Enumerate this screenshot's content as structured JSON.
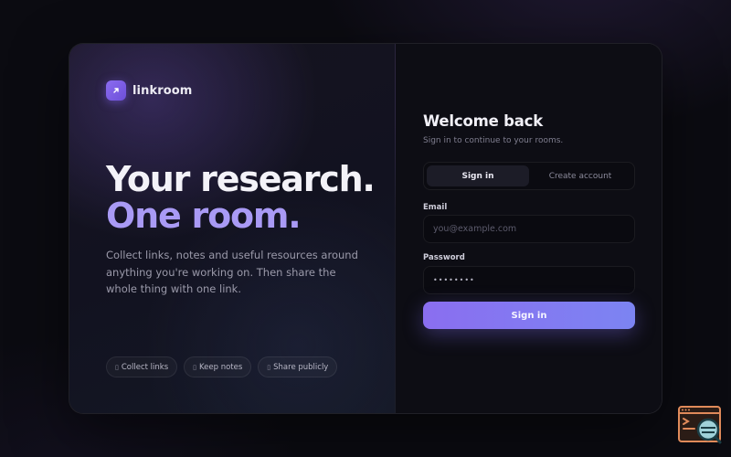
{
  "brand": {
    "name": "linkroom",
    "logo_icon": "arrow-up-right-icon"
  },
  "hero": {
    "line1": "Your research.",
    "line2": "One room.",
    "description": "Collect links, notes and useful resources around anything you're working on. Then share the whole thing with one link."
  },
  "chips": [
    {
      "label": "Collect links",
      "icon": "link-icon"
    },
    {
      "label": "Keep notes",
      "icon": "note-icon"
    },
    {
      "label": "Share publicly",
      "icon": "share-icon"
    }
  ],
  "auth": {
    "title": "Welcome back",
    "subtitle": "Sign in to continue to your rooms.",
    "tabs": [
      {
        "label": "Sign in",
        "active": true
      },
      {
        "label": "Create account",
        "active": false
      }
    ],
    "email": {
      "label": "Email",
      "placeholder": "you@example.com",
      "value": ""
    },
    "password": {
      "label": "Password",
      "value": "••••••••"
    },
    "submit_label": "Sign in"
  },
  "colors": {
    "accent": "#8b6cf0",
    "accent_light": "#a99af5",
    "background": "#0b0b11",
    "card": "#0e0e15"
  }
}
